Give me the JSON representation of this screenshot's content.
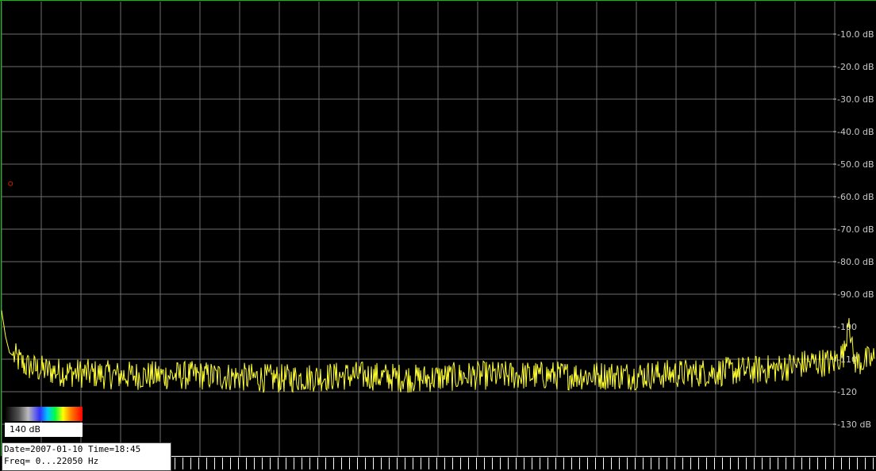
{
  "chart_data": {
    "type": "line",
    "title": "",
    "xlabel": "",
    "ylabel": "",
    "y_unit": "dB",
    "ylim": [
      -135,
      0
    ],
    "y_ticks": [
      {
        "value": -10,
        "label": "-10.0 dB"
      },
      {
        "value": -20,
        "label": "-20.0 dB"
      },
      {
        "value": -30,
        "label": "-30.0 dB"
      },
      {
        "value": -40,
        "label": "-40.0 dB"
      },
      {
        "value": -50,
        "label": "-50.0 dB"
      },
      {
        "value": -60,
        "label": "-60.0 dB"
      },
      {
        "value": -70,
        "label": "-70.0 dB"
      },
      {
        "value": -80,
        "label": "-80.0 dB"
      },
      {
        "value": -90,
        "label": "-90.0 dB"
      },
      {
        "value": -100,
        "label": "-100"
      },
      {
        "value": -110,
        "label": "-110"
      },
      {
        "value": -120,
        "label": "-120"
      },
      {
        "value": -130,
        "label": "-130 dB"
      }
    ],
    "xlim": [
      0,
      22050
    ],
    "x_unit": "Hz",
    "grid": true,
    "series": [
      {
        "color": "#ffff33",
        "x": [
          0,
          100,
          200,
          400,
          600,
          900,
          1500,
          3000,
          5000,
          7000,
          9000,
          10500,
          12000,
          14000,
          16000,
          18000,
          19500,
          20500,
          21000,
          21300,
          21400,
          21500,
          21600,
          22050
        ],
        "y": [
          -95,
          -103,
          -108,
          -110,
          -112,
          -113,
          -114,
          -115,
          -115,
          -116,
          -115,
          -116,
          -115,
          -115,
          -115,
          -114,
          -113,
          -111,
          -111,
          -108,
          -95,
          -109,
          -111,
          -110
        ]
      }
    ]
  },
  "marker": {
    "freq": 225,
    "level_db": -56,
    "color": "#cc2200"
  },
  "colors": {
    "background": "#000000",
    "grid": "#6e6e6e",
    "axis_line": "#00c800",
    "trace": "#ffff33"
  },
  "color_scale": {
    "range_label": "140 dB"
  },
  "info": {
    "date_line": "Date=2007-01-10 Time=18:45",
    "freq_line": "Freq= 0...22050 Hz"
  }
}
